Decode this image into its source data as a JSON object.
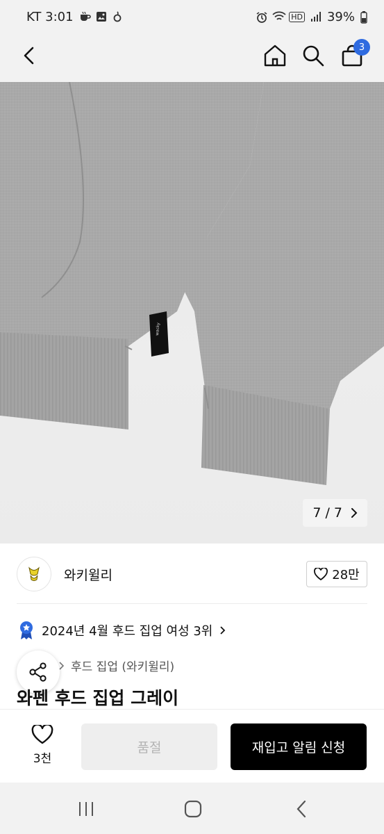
{
  "status_bar": {
    "carrier_time": "KT 3:01",
    "battery": "39%"
  },
  "header": {
    "cart_count": "3"
  },
  "gallery": {
    "counter": "7 / 7"
  },
  "brand": {
    "name": "와키윌리",
    "likes": "28만"
  },
  "ranking": {
    "text": "2024년 4월 후드 집업 여성 3위"
  },
  "category": {
    "text": "후드 집업 (와키윌리)"
  },
  "product": {
    "title": "와펜 후드 집업 그레이"
  },
  "actions": {
    "wish_count": "3천",
    "soldout_label": "품절",
    "restock_label": "재입고 알림 신청"
  },
  "colors": {
    "badge_blue": "#2f6be0",
    "sweater_gray": "#a9a9a9",
    "primary_black": "#000000"
  }
}
